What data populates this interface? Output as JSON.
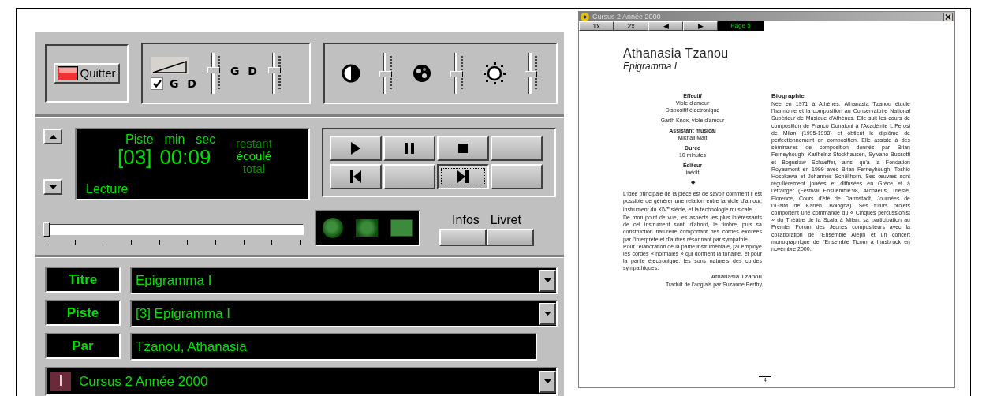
{
  "player": {
    "quit_button": {
      "label": "Quitter"
    },
    "volume": {
      "linked": {
        "checked": true,
        "label": "G D"
      },
      "sliders": [
        {
          "level": 0.55
        },
        {
          "label": "G D",
          "level": 0.55
        }
      ]
    },
    "image": {
      "sliders": [
        {
          "kind": "contrast",
          "level": 0.45
        },
        {
          "kind": "color",
          "level": 0.45
        },
        {
          "kind": "brightness",
          "level": 0.45
        }
      ]
    },
    "display": {
      "labels": [
        "Piste",
        "min",
        "sec"
      ],
      "track": "[03]",
      "time": "00:09",
      "modes": [
        {
          "label": "restant",
          "selected": false
        },
        {
          "label": "écoulé",
          "selected": true
        },
        {
          "label": "total",
          "selected": false
        }
      ],
      "status": "Lecture"
    },
    "transport": [
      {
        "kind": "play",
        "focused": false
      },
      {
        "kind": "pause",
        "focused": false
      },
      {
        "kind": "stop",
        "focused": false
      },
      {
        "kind": "blank",
        "focused": false
      },
      {
        "kind": "previous",
        "focused": false
      },
      {
        "kind": "blank",
        "focused": false
      },
      {
        "kind": "next",
        "focused": true
      },
      {
        "kind": "blank",
        "focused": false
      }
    ],
    "position": {
      "level": 0
    },
    "view_modes": [
      {
        "kind": "small"
      },
      {
        "kind": "medium"
      },
      {
        "kind": "full"
      }
    ],
    "info_buttons": [
      "Infos",
      "Livret"
    ],
    "fields": [
      {
        "label": "Titre",
        "value": "Epigramma I",
        "dropdown": true
      },
      {
        "label": "Piste",
        "value": "[3] Epigramma I",
        "dropdown": true
      },
      {
        "label": "Par",
        "value": "Tzanou, Athanasia",
        "dropdown": false
      }
    ],
    "album": {
      "icon_letter": "I",
      "value": "Cursus 2 Année 2000"
    }
  },
  "booklet": {
    "window": {
      "title": "Cursus 2 Année 2000"
    },
    "toolbar": [
      {
        "label": "1x",
        "kind": "button"
      },
      {
        "label": "2x",
        "kind": "button"
      },
      {
        "label": "◀",
        "kind": "button"
      },
      {
        "label": "▶",
        "kind": "button"
      },
      {
        "label": "Page 5",
        "kind": "readout"
      }
    ],
    "page": {
      "heading": "Athanasia Tzanou",
      "subtitle": "Epigramma I",
      "credits": [
        {
          "title": "Effectif",
          "lines": [
            "Viole d'amour",
            "Dispositif électronique"
          ]
        },
        {
          "lines": [
            "Garth Knox, viole d'amour"
          ]
        },
        {
          "title": "Assistant musical",
          "lines": [
            "Mikhail Malt"
          ]
        },
        {
          "title": "Durée",
          "lines": [
            "10 minutes"
          ]
        },
        {
          "title": "Éditeur",
          "lines": [
            "inédit"
          ]
        }
      ],
      "separator": "◆",
      "notes": [
        "L'idée principale de la pièce est de savoir comment il est possible de générer une relation entre la viole d'amour, instrument du XIV$^{e}$ siècle, et la technologie musicale.",
        "De mon point de vue, les aspects les plus intéressants de cet instrument sont, d'abord, le timbre, puis sa construction naturelle comportant des cordes excitées par l'interprète et d'autres résonnant par sympathie.",
        "Pour l'élaboration de la partie instrumentale, j'ai employé les cordes « normales » qui donnent la tonalité, et pour la partie électronique, les sons naturels des cordes sympathiques."
      ],
      "signature": "Athanasia Tzanou",
      "translation": "Traduit de l'anglais par Suzanne Berthy",
      "bio_title": "Biographie",
      "bio": "Née en 1971 à Athènes, Athanasia Tzanou étudie l'harmonie et la composition au Conservatoire National Supérieur de Musique d'Athènes. Elle suit les cours de composition de Franco Donatoni à l'Académie L.Perosi de Milan (1995-1998) et obtient le diplôme de perfectionnement en composition. Elle assiste à des séminaires de composition donnés par Brian Ferneyhough, Karlheinz Stockhausen, Sylvano Bussotti et Boguslaw Schaeffer, ainsi qu'à la Fondation Royaumont en 1999 avec Brian Ferneyhough, Toshio Hosokawa et Johannes Schöllhorn. Ses œuvres sont régulièrement jouées et diffusées en Grèce et à l'étranger (Festival Ensuemble'98, Archaeus, Trieste, Florence, Cours d'été de Darmstadt, Journées de l'IGNM de Karlen, Bologna). Ses futurs projets comportent une commande du « Cinques percussionist » du Théâtre de la Scala à Milan, sa participation au Premier Forum des Jeunes compositeurs avec la collaboration de l'Ensemble Aleph et un concert monographique de l'Ensemble Ticom à Innsbruck en novembre 2000.",
      "page_number": "4"
    }
  }
}
